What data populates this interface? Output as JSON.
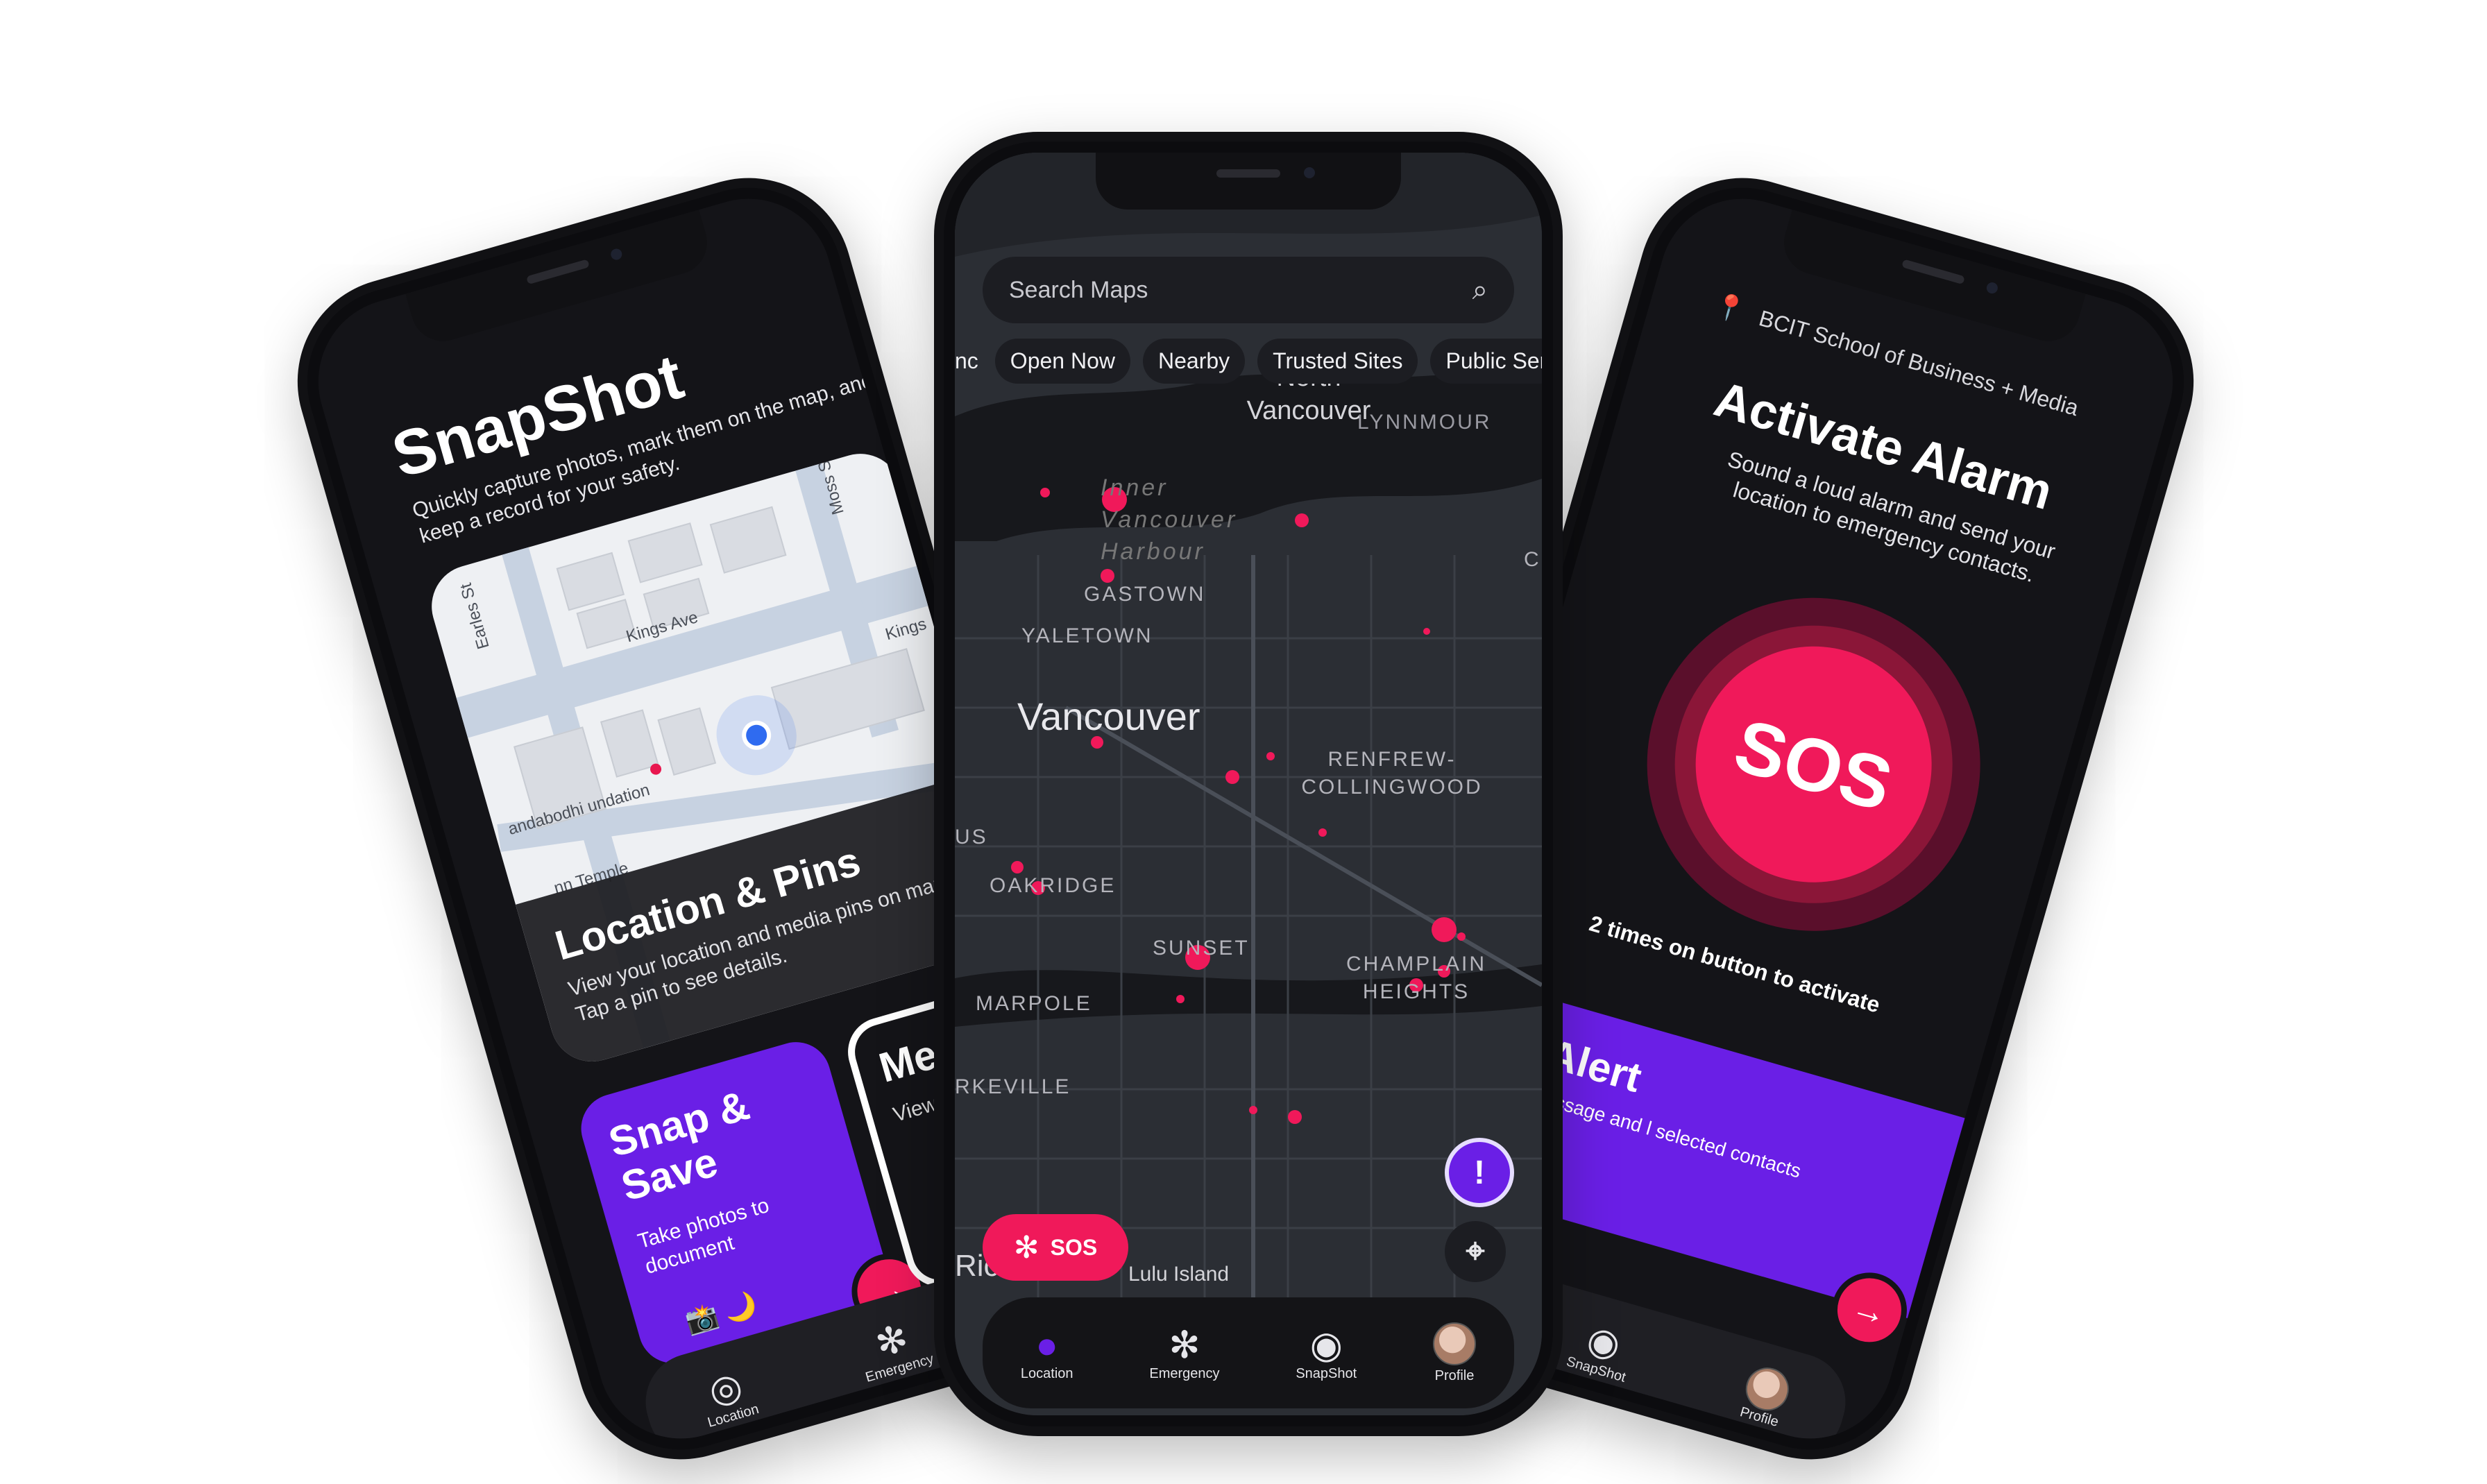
{
  "left_phone": {
    "title": "SnapShot",
    "subtitle": "Quickly capture photos, mark them on the map, and keep a record for your safety.",
    "map_streets": [
      "Earles St",
      "Kings Ave",
      "Moss St",
      "Kings",
      "andabodhi undation",
      "nn Temple"
    ],
    "map_card": {
      "title": "Location & Pins",
      "description": "View your location and media pins on map. Tap a pin to see details."
    },
    "snap_save": {
      "title": "Snap & Save",
      "description": "Take photos to document"
    },
    "media_history": {
      "title": "Med His",
      "description": "View pho"
    },
    "nav": {
      "location": "Location",
      "emergency": "Emergency"
    }
  },
  "center_phone": {
    "search_placeholder": "Search Maps",
    "chips": [
      "Open Now",
      "Nearby",
      "Trusted Sites",
      "Public Ser"
    ],
    "chip_prefix": "nc",
    "map_labels": {
      "north_vancouver": "North Vancouver",
      "lynnmour": "LYNNMOUR",
      "inner_harbour": "Inner Vancouver Harbour",
      "gastown": "GASTOWN",
      "yaletown": "YALETOWN",
      "vancouver": "Vancouver",
      "renfrew": "RENFREW-COLLINGWOOD",
      "us": "US",
      "oakridge": "OAKRIDGE",
      "sunset": "SUNSET",
      "champlain": "CHAMPLAIN HEIGHTS",
      "marpole": "MARPOLE",
      "kerkeville": "RKEVILLE",
      "richmond": "Richmond",
      "lulu": "Lulu Island",
      "c": "C"
    },
    "sos_label": "SOS",
    "nav": {
      "location": "Location",
      "emergency": "Emergency",
      "snapshot": "SnapShot",
      "profile": "Profile"
    },
    "colors": {
      "accent_purple": "#6a1fe6",
      "sos_pink": "#f0195a"
    }
  },
  "right_phone": {
    "location": "BCIT School of Business + Media",
    "title": "Activate Alarm",
    "subtitle": "Sound a loud alarm and send your location to emergency contacts.",
    "sos_label": "SOS",
    "tap_hint": "2 times on button to activate",
    "alert_card": {
      "title": "ncy Alert",
      "description": "ergency message and l selected contacts"
    },
    "nav": {
      "snapshot": "SnapShot",
      "profile": "Profile"
    }
  }
}
